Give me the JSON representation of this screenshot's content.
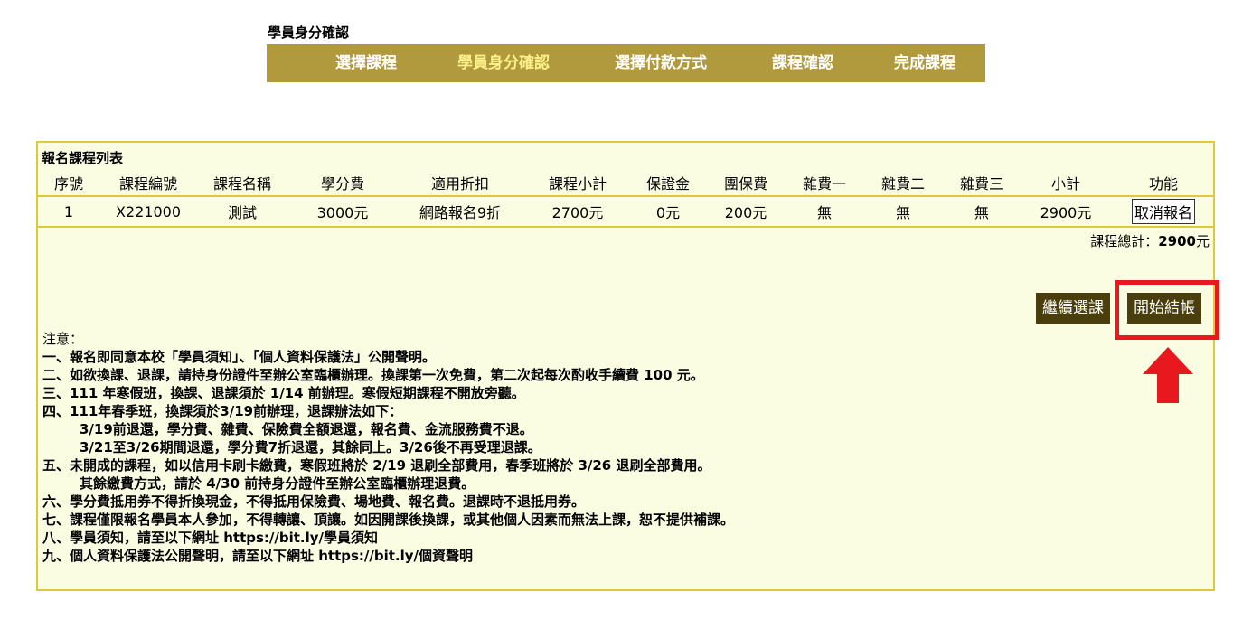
{
  "page_heading": "學員身分確認",
  "steps": [
    {
      "label": "選擇課程",
      "active": false
    },
    {
      "label": "學員身分確認",
      "active": true
    },
    {
      "label": "選擇付款方式",
      "active": false
    },
    {
      "label": "課程確認",
      "active": false
    },
    {
      "label": "完成課程",
      "active": false
    }
  ],
  "panel_title": "報名課程列表",
  "table": {
    "headers": [
      "序號",
      "課程編號",
      "課程名稱",
      "學分費",
      "適用折扣",
      "課程小計",
      "保證金",
      "團保費",
      "雜費一",
      "雜費二",
      "雜費三",
      "小計",
      "功能"
    ],
    "rows": [
      [
        "1",
        "X221000",
        "測試",
        "3000元",
        "網路報名9折",
        "2700元",
        "0元",
        "200元",
        "無",
        "無",
        "無",
        "2900元"
      ]
    ],
    "cancel_label": "取消報名"
  },
  "total": {
    "label": "課程總計：",
    "value": "2900",
    "unit": "元"
  },
  "buttons": {
    "continue": "繼續選課",
    "checkout": "開始結帳"
  },
  "colors": {
    "step_bar": "#b19a3d",
    "panel_bg": "#fbfde3",
    "panel_border": "#dbcb3c",
    "dark_button": "#4a3f0c",
    "highlight": "#e8191e"
  },
  "notes": {
    "heading": "注意：",
    "lines": [
      "一、報名即同意本校「學員須知」、「個人資料保護法」公開聲明。",
      "二、如欲換課、退課，請持身份證件至辦公室臨櫃辦理。換課第一次免費，第二次起每次酌收手續費 100 元。",
      "三、111 年寒假班，換課、退課須於 1/14 前辦理。寒假短期課程不開放旁聽。",
      "四、111年春季班，換課須於3/19前辦理，退課辦法如下：",
      "3/19前退還，學分費、雜費、保險費全額退還，報名費、金流服務費不退。",
      "3/21至3/26期間退還，學分費7折退還，其餘同上。3/26後不再受理退課。",
      "五、未開成的課程，如以信用卡刷卡繳費，寒假班將於 2/19 退刷全部費用，春季班將於 3/26 退刷全部費用。",
      "其餘繳費方式，請於 4/30 前持身分證件至辦公室臨櫃辦理退費。",
      "六、學分費抵用券不得折換現金，不得抵用保險費、場地費、報名費。退課時不退抵用券。",
      "七、課程僅限報名學員本人參加，不得轉讓、頂讓。如因開課後換課，或其他個人因素而無法上課，恕不提供補課。",
      "八、學員須知，請至以下網址 https://bit.ly/學員須知",
      "九、個人資料保護法公開聲明，請至以下網址 https://bit.ly/個資聲明"
    ]
  }
}
